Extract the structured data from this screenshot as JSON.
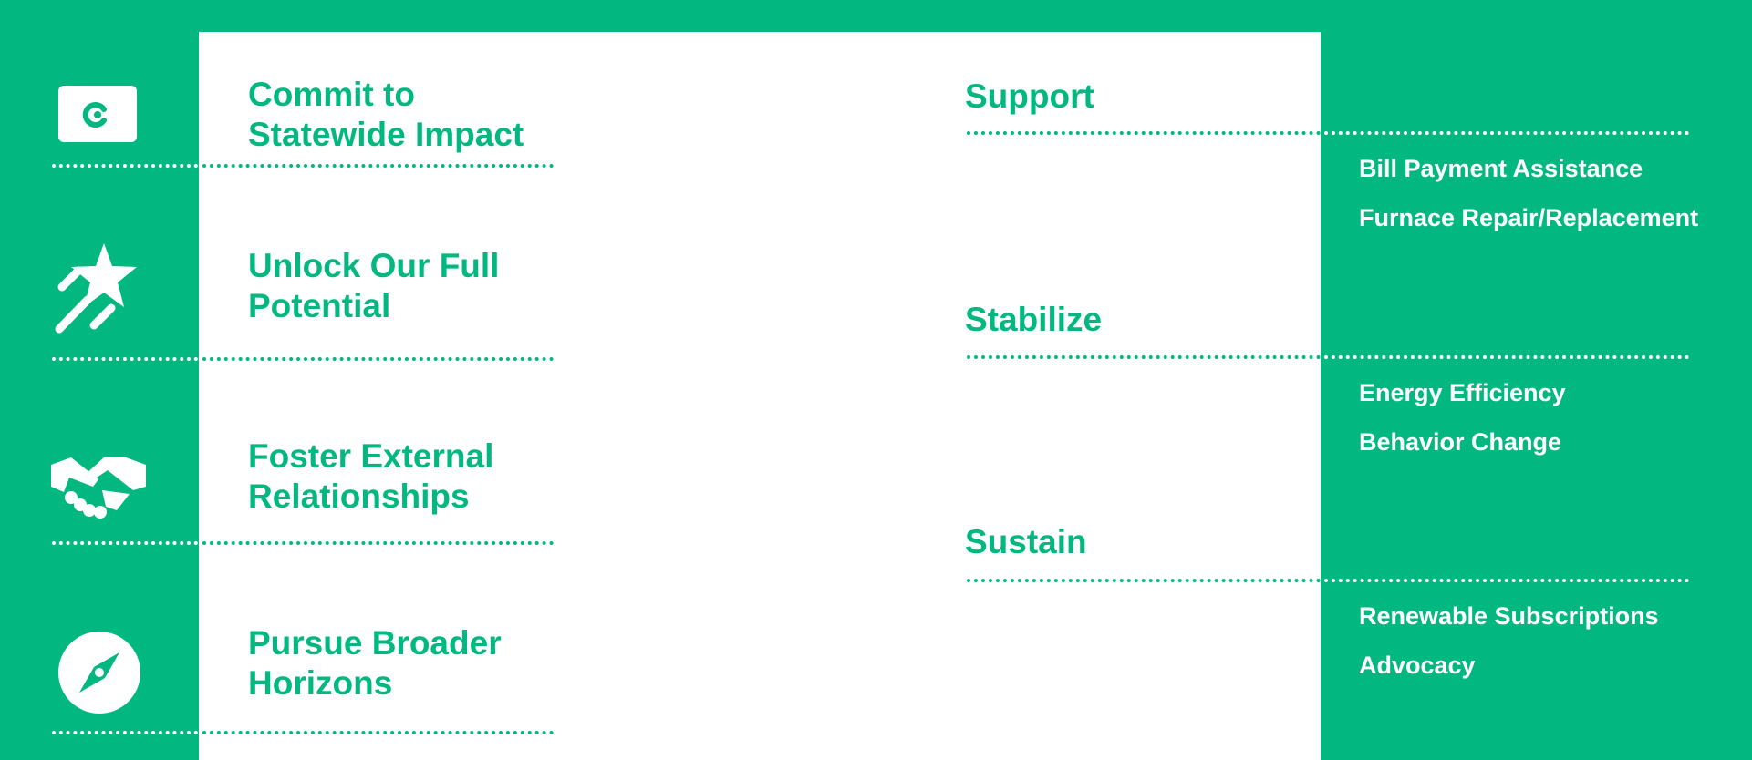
{
  "colors": {
    "brand_green": "#03b880",
    "white": "#ffffff"
  },
  "goals": [
    {
      "icon": "colorado-flag-icon",
      "line1": "Commit to",
      "line2": "Statewide Impact"
    },
    {
      "icon": "shooting-star-icon",
      "line1": "Unlock Our Full",
      "line2": "Potential"
    },
    {
      "icon": "handshake-icon",
      "line1": "Foster External",
      "line2": "Relationships"
    },
    {
      "icon": "compass-icon",
      "line1": "Pursue Broader",
      "line2": "Horizons"
    }
  ],
  "pillars": [
    {
      "title": "Support",
      "items": [
        "Bill Payment Assistance",
        "Furnace Repair/Replacement"
      ]
    },
    {
      "title": "Stabilize",
      "items": [
        "Energy Efficiency",
        "Behavior Change"
      ]
    },
    {
      "title": "Sustain",
      "items": [
        "Renewable Subscriptions",
        "Advocacy"
      ]
    }
  ]
}
